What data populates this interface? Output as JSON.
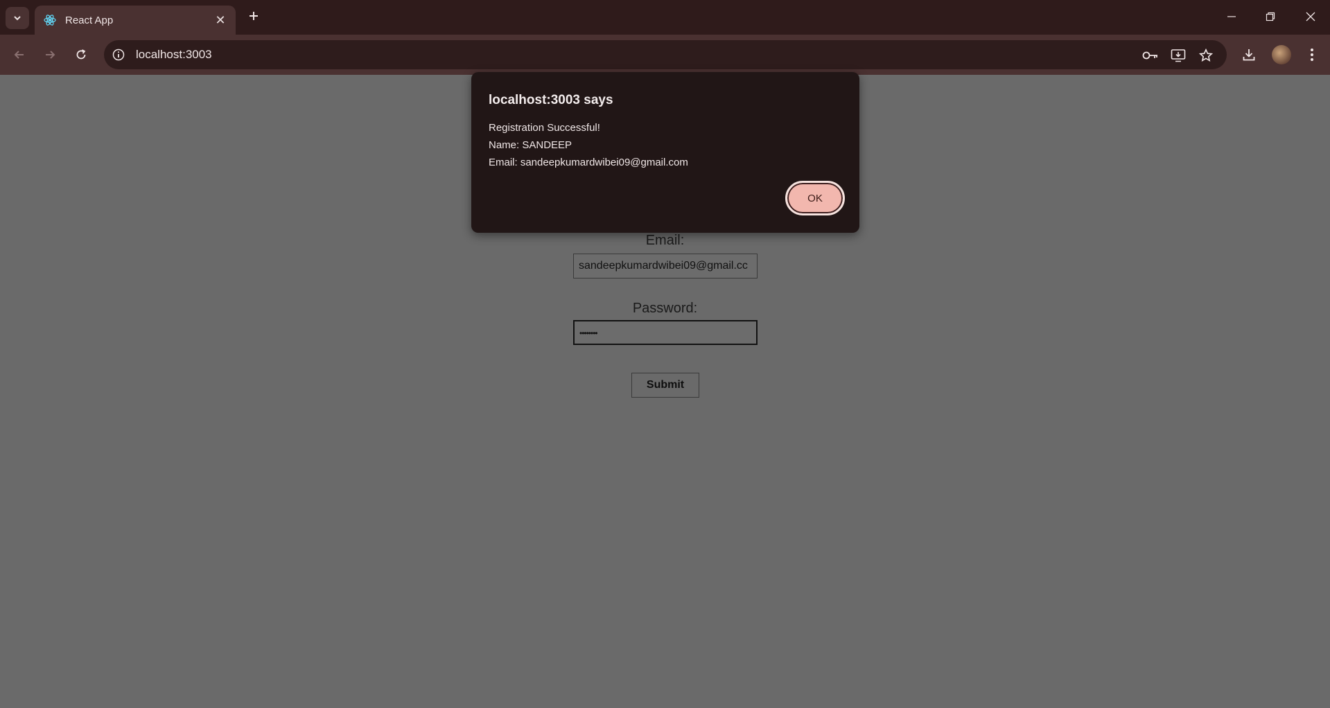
{
  "browser": {
    "tab_title": "React App",
    "url": "localhost:3003"
  },
  "form": {
    "email_label": "Email:",
    "email_value": "sandeepkumardwibei09@gmail.cc",
    "password_label": "Password:",
    "password_value": "••••••••",
    "submit_label": "Submit"
  },
  "dialog": {
    "title": "localhost:3003 says",
    "line1": "Registration Successful!",
    "line2": "Name: SANDEEP",
    "line3": "Email: sandeepkumardwibei09@gmail.com",
    "ok_label": "OK"
  },
  "icons": {
    "tab_search": "chevron-down-icon",
    "favicon": "react-icon",
    "back": "arrow-left-icon",
    "forward": "arrow-right-icon",
    "reload": "reload-icon",
    "site_info": "info-icon",
    "password": "key-icon",
    "install": "install-app-icon",
    "bookmark": "star-icon",
    "download": "download-icon",
    "menu": "more-vertical-icon"
  },
  "colors": {
    "titlebar": "#2f1b1b",
    "toolbar": "#4a3131",
    "dialog_bg": "#211616",
    "ok_button": "#f2b7ae",
    "page_overlay": "#6a6a6a"
  }
}
